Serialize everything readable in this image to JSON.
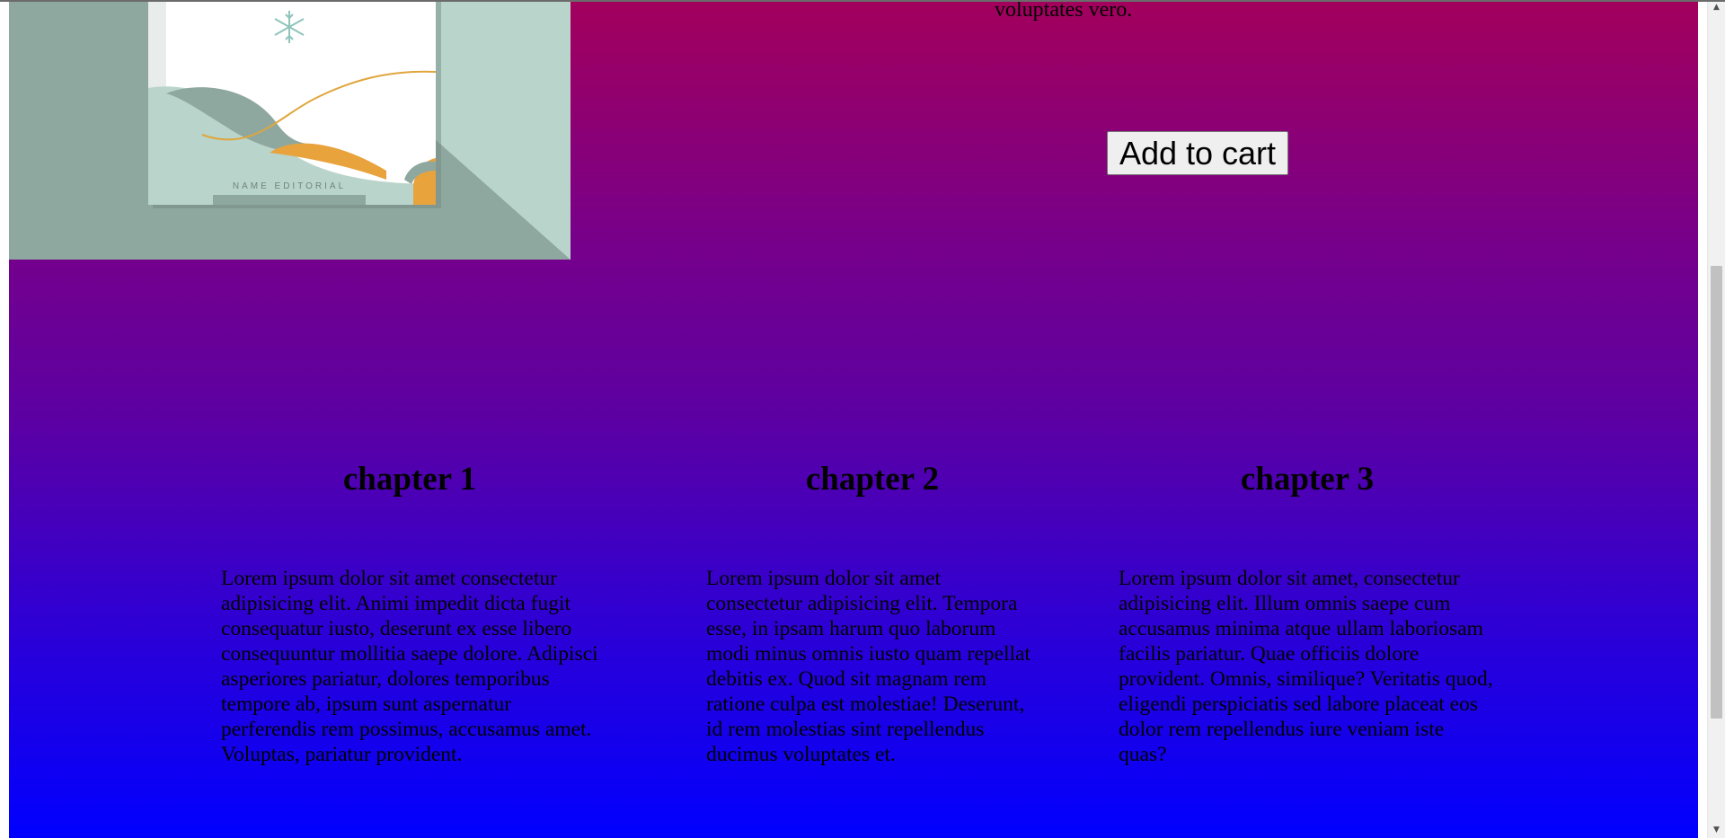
{
  "hero": {
    "snippet_text": "voluptates vero.",
    "cover_publisher": "NAME EDITORIAL",
    "add_to_cart_label": "Add to cart"
  },
  "chapters": [
    {
      "title": "chapter 1",
      "body": "Lorem ipsum dolor sit amet consectetur adipisicing elit. Animi impedit dicta fugit consequatur iusto, deserunt ex esse libero consequuntur mollitia saepe dolore. Adipisci asperiores pariatur, dolores temporibus tempore ab, ipsum sunt aspernatur perferendis rem possimus, accusamus amet. Voluptas, pariatur provident."
    },
    {
      "title": "chapter 2",
      "body": "Lorem ipsum dolor sit amet consectetur adipisicing elit. Tempora esse, in ipsam harum quo laborum modi minus omnis iusto quam repellat debitis ex. Quod sit magnam rem ratione culpa est molestiae! Deserunt, id rem molestias sint repellendus ducimus voluptates et."
    },
    {
      "title": "chapter 3",
      "body": "Lorem ipsum dolor sit amet, consectetur adipisicing elit. Illum omnis saepe cum accusamus minima atque ullam laboriosam facilis pariatur. Quae officiis dolore provident. Omnis, similique? Veritatis quod, eligendi perspiciatis sed labore placeat eos dolor rem repellendus iure veniam iste quas?"
    }
  ],
  "colors": {
    "gradient_top": "#a3005c",
    "gradient_bottom": "#0000ff",
    "cover_bg": "#8fa89f",
    "cover_accent": "#e8a33d"
  },
  "icons": {
    "cover_ornament": "snowflake-icon",
    "scroll_up": "arrow-up-icon",
    "scroll_down": "arrow-down-icon"
  }
}
